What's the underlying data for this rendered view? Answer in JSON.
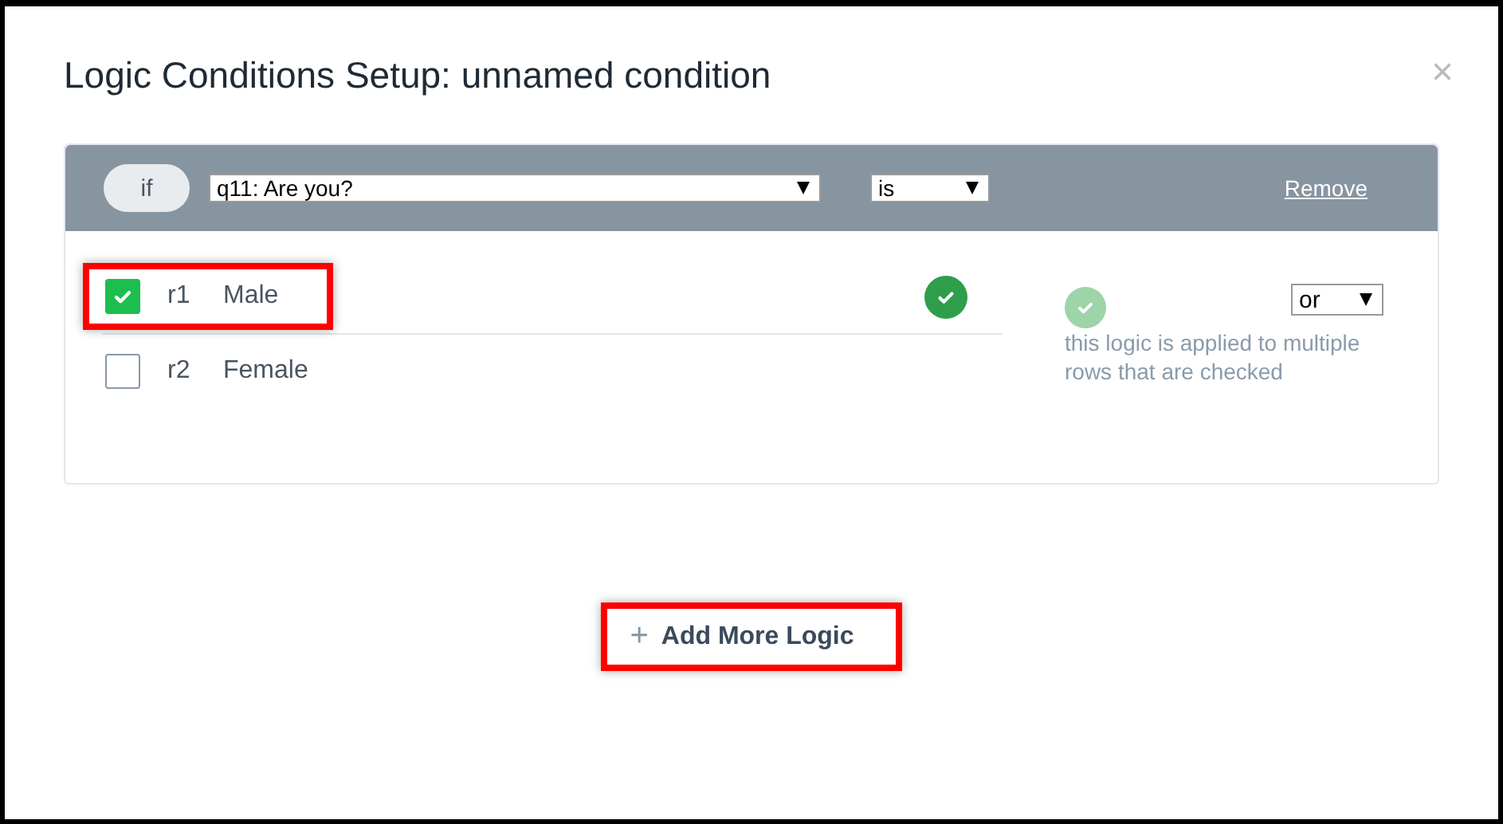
{
  "dialog": {
    "title": "Logic Conditions Setup: unnamed condition",
    "close": "×"
  },
  "condition": {
    "connector": "if",
    "question": "q11: Are you?",
    "operator": "is",
    "remove": "Remove",
    "rows": [
      {
        "code": "r1",
        "label": "Male",
        "checked": true,
        "highlighted": true
      },
      {
        "code": "r2",
        "label": "Female",
        "checked": false,
        "highlighted": false
      }
    ],
    "combine": "or",
    "note": "this logic is applied to multiple rows that are checked"
  },
  "add_button": {
    "icon": "+",
    "label": "Add More Logic",
    "highlighted": true
  }
}
